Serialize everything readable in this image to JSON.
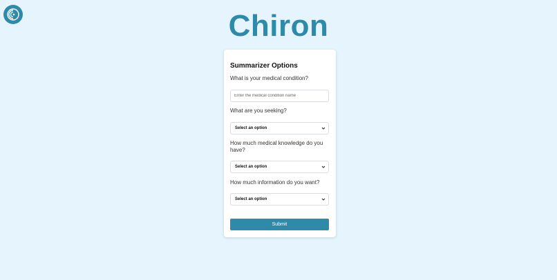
{
  "app": {
    "title": "Chiron",
    "logo_icon": "chiron-logo-icon",
    "brand_color": "#2d8ba9",
    "background_color": "#e6f5fd"
  },
  "form": {
    "title": "Summarizer Options",
    "condition": {
      "label": "What is your medical condition?",
      "placeholder": "Enter the medical condition name",
      "value": ""
    },
    "seeking": {
      "label": "What are you seeking?",
      "selected": "Select an option"
    },
    "knowledge": {
      "label": "How much medical knowledge do you have?",
      "selected": "Select an option"
    },
    "information": {
      "label": "How much information do you want?",
      "selected": "Select an option"
    },
    "submit_label": "Submit",
    "dropdown_icon": "chevron-down-icon"
  }
}
